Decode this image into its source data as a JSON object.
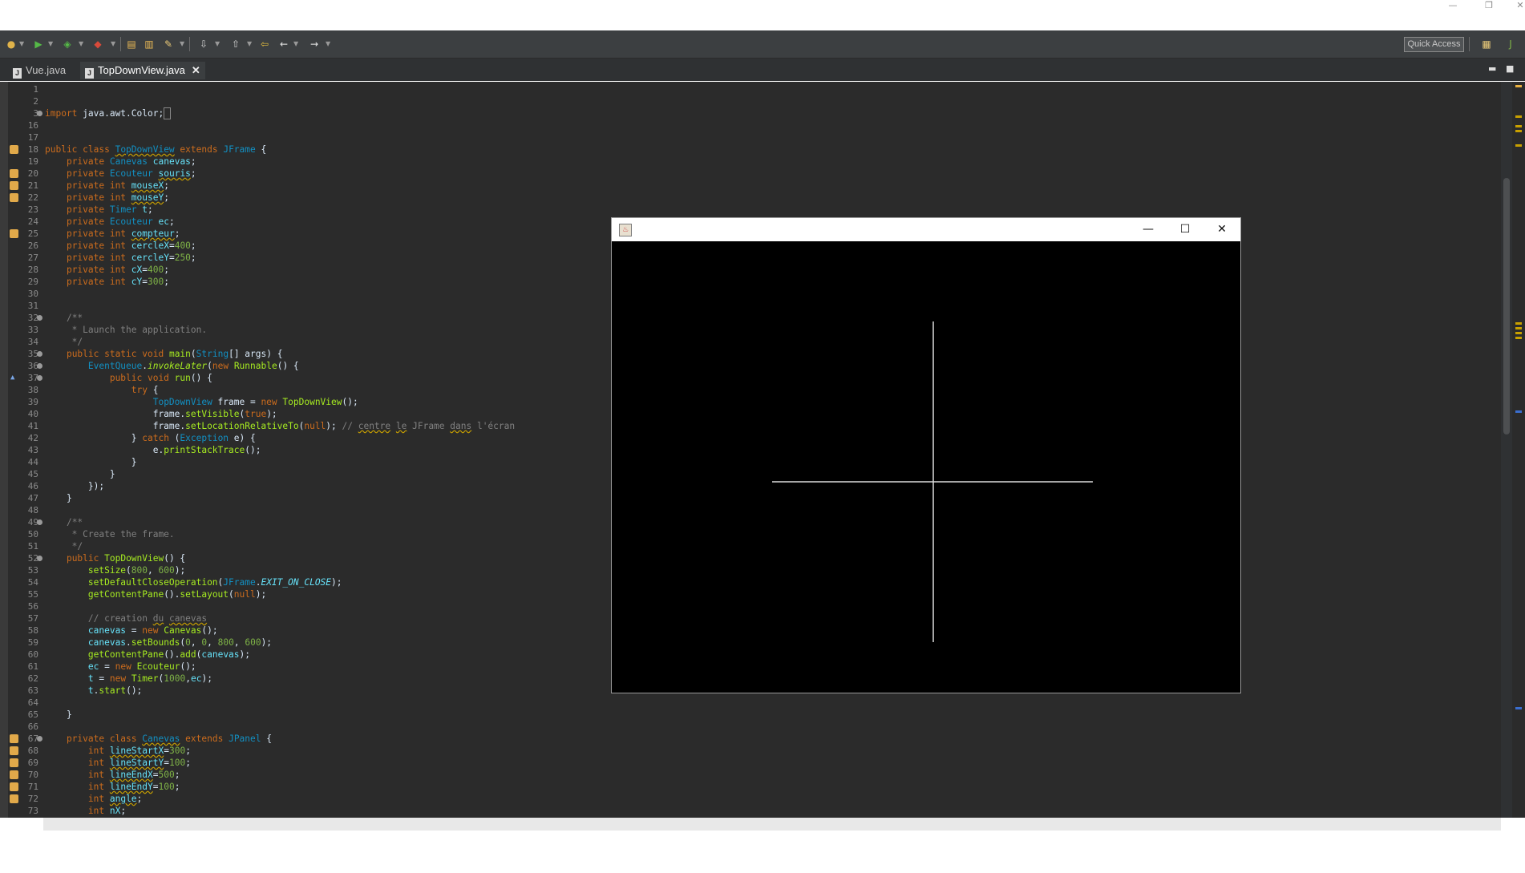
{
  "window_controls": {
    "minimize": "—",
    "restore": "❐",
    "close": "✕"
  },
  "toolbar": {
    "quick_access": "Quick Access"
  },
  "tabs": [
    {
      "label": "Vue.java",
      "active": false
    },
    {
      "label": "TopDownView.java",
      "active": true
    }
  ],
  "tab_close": "✕",
  "editor": {
    "lines": [
      {
        "n": "1",
        "html": ""
      },
      {
        "n": "2",
        "html": ""
      },
      {
        "n": "3",
        "fold": true,
        "html": "<span class=\"kw\">import</span> java.awt.Color;<span style=\"border:1px solid #888;\">&nbsp;</span>"
      },
      {
        "n": "16",
        "html": ""
      },
      {
        "n": "17",
        "html": ""
      },
      {
        "n": "18",
        "ann": true,
        "html": "<span class=\"kw\">public class</span> <span class=\"ty sq\">TopDownView</span> <span class=\"kw\">extends</span> <span class=\"ty\">JFrame</span> {"
      },
      {
        "n": "19",
        "html": "    <span class=\"kw\">private</span> <span class=\"ty\">Canevas</span> <span class=\"fd\">canevas</span>;"
      },
      {
        "n": "20",
        "ann": true,
        "html": "    <span class=\"kw\">private</span> <span class=\"ty\">Ecouteur</span> <span class=\"fd sq\">souris</span>;"
      },
      {
        "n": "21",
        "ann": true,
        "html": "    <span class=\"kw\">private int</span> <span class=\"fd sq\">mouseX</span>;"
      },
      {
        "n": "22",
        "ann": true,
        "html": "    <span class=\"kw\">private int</span> <span class=\"fd sq\">mouseY</span>;"
      },
      {
        "n": "23",
        "html": "    <span class=\"kw\">private</span> <span class=\"ty\">Timer</span> <span class=\"fd\">t</span>;"
      },
      {
        "n": "24",
        "html": "    <span class=\"kw\">private</span> <span class=\"ty\">Ecouteur</span> <span class=\"fd\">ec</span>;"
      },
      {
        "n": "25",
        "ann": true,
        "html": "    <span class=\"kw\">private int</span> <span class=\"fd sq\">compteur</span>;"
      },
      {
        "n": "26",
        "html": "    <span class=\"kw\">private int</span> <span class=\"fd\">cercleX</span>=<span class=\"num\">400</span>;"
      },
      {
        "n": "27",
        "html": "    <span class=\"kw\">private int</span> <span class=\"fd\">cercleY</span>=<span class=\"num\">250</span>;"
      },
      {
        "n": "28",
        "html": "    <span class=\"kw\">private int</span> <span class=\"fd\">cX</span>=<span class=\"num\">400</span>;"
      },
      {
        "n": "29",
        "html": "    <span class=\"kw\">private int</span> <span class=\"fd\">cY</span>=<span class=\"num\">300</span>;"
      },
      {
        "n": "30",
        "html": ""
      },
      {
        "n": "31",
        "html": ""
      },
      {
        "n": "32",
        "fold": true,
        "html": "    <span class=\"cm\">/**</span>"
      },
      {
        "n": "33",
        "html": "<span class=\"cm\">     * Launch the application.</span>"
      },
      {
        "n": "34",
        "html": "<span class=\"cm\">     */</span>"
      },
      {
        "n": "35",
        "fold": true,
        "html": "    <span class=\"kw\">public static void</span> <span class=\"mt\">main</span>(<span class=\"ty\">String</span>[] args) {"
      },
      {
        "n": "36",
        "fold": true,
        "html": "        <span class=\"ty\">EventQueue</span>.<span class=\"mt it\">invokeLater</span>(<span class=\"kw\">new</span> <span class=\"mt\">Runnable</span>() {"
      },
      {
        "n": "37",
        "fold": true,
        "arrow": true,
        "html": "            <span class=\"kw\">public void</span> <span class=\"mt\">run</span>() {"
      },
      {
        "n": "38",
        "html": "                <span class=\"kw\">try</span> {"
      },
      {
        "n": "39",
        "html": "                    <span class=\"ty\">TopDownView</span> frame = <span class=\"kw\">new</span> <span class=\"mt\">TopDownView</span>();"
      },
      {
        "n": "40",
        "html": "                    frame.<span class=\"mt\">setVisible</span>(<span class=\"kw\">true</span>);"
      },
      {
        "n": "41",
        "html": "                    frame.<span class=\"mt\">setLocationRelativeTo</span>(<span class=\"kw\">null</span>); <span class=\"cm\">// <span class=\"sq\">centre</span> <span class=\"sq\">le</span> JFrame <span class=\"sq\">dans</span> l'écran</span>"
      },
      {
        "n": "42",
        "html": "                } <span class=\"kw\">catch</span> (<span class=\"ty\">Exception</span> e) {"
      },
      {
        "n": "43",
        "html": "                    e.<span class=\"mt\">printStackTrace</span>();"
      },
      {
        "n": "44",
        "html": "                }"
      },
      {
        "n": "45",
        "html": "            }"
      },
      {
        "n": "46",
        "html": "        });"
      },
      {
        "n": "47",
        "html": "    }"
      },
      {
        "n": "48",
        "html": ""
      },
      {
        "n": "49",
        "fold": true,
        "html": "    <span class=\"cm\">/**</span>"
      },
      {
        "n": "50",
        "html": "<span class=\"cm\">     * Create the frame.</span>"
      },
      {
        "n": "51",
        "html": "<span class=\"cm\">     */</span>"
      },
      {
        "n": "52",
        "fold": true,
        "html": "    <span class=\"kw\">public</span> <span class=\"mt\">TopDownView</span>() {"
      },
      {
        "n": "53",
        "html": "        <span class=\"mt\">setSize</span>(<span class=\"num\">800</span>, <span class=\"num\">600</span>);"
      },
      {
        "n": "54",
        "html": "        <span class=\"mt\">setDefaultCloseOperation</span>(<span class=\"ty\">JFrame</span>.<span class=\"fd it\">EXIT_ON_CLOSE</span>);"
      },
      {
        "n": "55",
        "html": "        <span class=\"mt\">getContentPane</span>().<span class=\"mt\">setLayout</span>(<span class=\"kw\">null</span>);"
      },
      {
        "n": "56",
        "html": ""
      },
      {
        "n": "57",
        "html": "        <span class=\"cm\">// creation <span class=\"sq\">du</span> <span class=\"sq\">canevas</span></span>"
      },
      {
        "n": "58",
        "html": "        <span class=\"fd\">canevas</span> = <span class=\"kw\">new</span> <span class=\"mt\">Canevas</span>();"
      },
      {
        "n": "59",
        "html": "        <span class=\"fd\">canevas</span>.<span class=\"mt\">setBounds</span>(<span class=\"num\">0</span>, <span class=\"num\">0</span>, <span class=\"num\">800</span>, <span class=\"num\">600</span>);"
      },
      {
        "n": "60",
        "html": "        <span class=\"mt\">getContentPane</span>().<span class=\"mt\">add</span>(<span class=\"fd\">canevas</span>);"
      },
      {
        "n": "61",
        "html": "        <span class=\"fd\">ec</span> = <span class=\"kw\">new</span> <span class=\"mt\">Ecouteur</span>();"
      },
      {
        "n": "62",
        "html": "        <span class=\"fd\">t</span> = <span class=\"kw\">new</span> <span class=\"mt\">Timer</span>(<span class=\"num\">1000</span>,<span class=\"fd\">ec</span>);"
      },
      {
        "n": "63",
        "html": "        <span class=\"fd\">t</span>.<span class=\"mt\">start</span>();"
      },
      {
        "n": "64",
        "html": ""
      },
      {
        "n": "65",
        "html": "    }"
      },
      {
        "n": "66",
        "html": ""
      },
      {
        "n": "67",
        "ann": true,
        "fold": true,
        "html": "    <span class=\"kw\">private class</span> <span class=\"ty sq\">Canevas</span> <span class=\"kw\">extends</span> <span class=\"ty\">JPanel</span> {"
      },
      {
        "n": "68",
        "ann": true,
        "html": "        <span class=\"kw\">int</span> <span class=\"fd sq\">lineStartX</span>=<span class=\"num\">300</span>;"
      },
      {
        "n": "69",
        "ann": true,
        "html": "        <span class=\"kw\">int</span> <span class=\"fd sq\">lineStartY</span>=<span class=\"num\">100</span>;"
      },
      {
        "n": "70",
        "ann": true,
        "html": "        <span class=\"kw\">int</span> <span class=\"fd sq\">lineEndX</span>=<span class=\"num\">500</span>;"
      },
      {
        "n": "71",
        "ann": true,
        "html": "        <span class=\"kw\">int</span> <span class=\"fd sq\">lineEndY</span>=<span class=\"num\">100</span>;"
      },
      {
        "n": "72",
        "ann": true,
        "html": "        <span class=\"kw\">int</span> <span class=\"fd sq\">angle</span>;"
      },
      {
        "n": "73",
        "html": "        <span class=\"kw\">int</span> <span class=\"fd\">nX</span>;"
      }
    ]
  },
  "app_window": {
    "controls": {
      "minimize": "—",
      "maximize": "☐",
      "close": "✕"
    }
  },
  "colors": {
    "editor_bg": "#2b2b2b",
    "keyword": "#cc6c1d",
    "type": "#1290c3",
    "method": "#a7ec21",
    "field": "#66e1f8",
    "annotation": "#e1a94a"
  }
}
